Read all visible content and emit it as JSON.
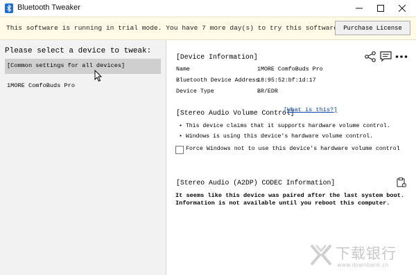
{
  "window": {
    "title": "Bluetooth Tweaker",
    "icons": {
      "app": "bluetooth-icon",
      "minimize": "minimize-icon",
      "maximize": "maximize-icon",
      "close": "close-icon"
    }
  },
  "trial": {
    "message": "This software is running in trial mode. You have 7 more day(s) to try this software.",
    "purchase_label": "Purchase License"
  },
  "left": {
    "prompt": "Please select a device to tweak:",
    "devices": [
      {
        "label": "[Common settings for all devices]",
        "selected": true
      },
      {
        "label": "1MORE ComfoBuds Pro",
        "selected": false
      }
    ]
  },
  "device_info": {
    "title": "[Device Information]",
    "rows": [
      {
        "label": "Name",
        "value": "1MORE ComfoBuds Pro"
      },
      {
        "label": "Bluetooth Device Address",
        "value": "18:95:52:bf:1d:17"
      },
      {
        "label": "Device Type",
        "value": "BR/EDR"
      }
    ],
    "icons": [
      "share-icon",
      "chat-icon",
      "more-icon"
    ]
  },
  "volume": {
    "title": "[Stereo Audio Volume Control]",
    "link": "[What is this?]",
    "bullets": [
      "This device claims that it supports hardware volume control.",
      "Windows is using this device's hardware volume control."
    ],
    "checkbox_label": "Force Windows not to use this device's hardware volume control",
    "checkbox_checked": false
  },
  "codec": {
    "title": "[Stereo Audio (A2DP) CODEC Information]",
    "lines": [
      "It seems like this device was paired after the last system boot.",
      "Information is not available until you reboot this computer."
    ]
  },
  "watermark": {
    "name": "下载银行",
    "url": "www.downbank.cn"
  },
  "colors": {
    "banner_bg": "#fffbe6",
    "left_bg": "#f2f2f2",
    "selected_bg": "#cfcfcf",
    "link": "#0645ad"
  }
}
